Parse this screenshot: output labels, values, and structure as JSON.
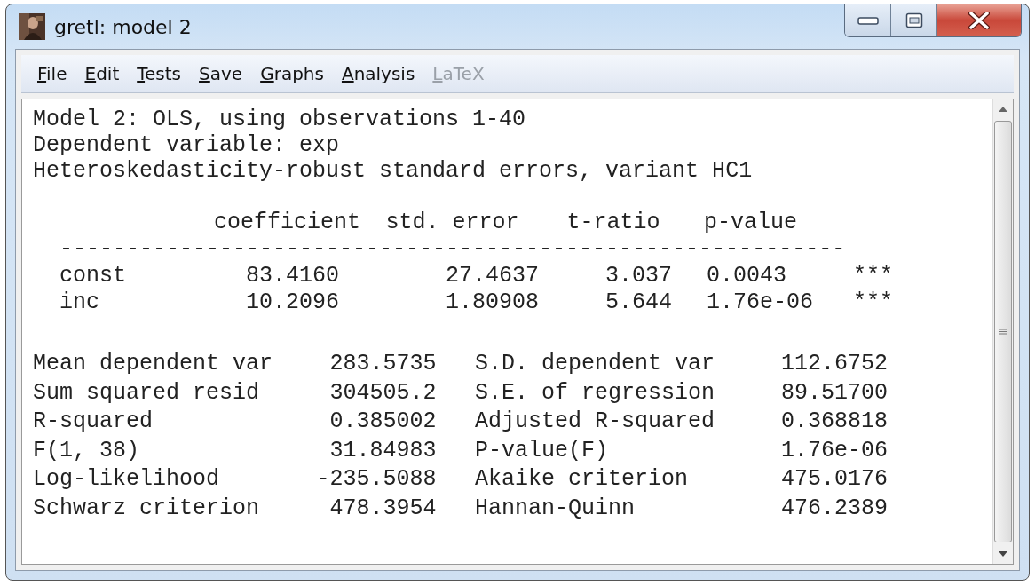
{
  "window": {
    "title": "gretl: model 2"
  },
  "menu": [
    {
      "label": "File",
      "disabled": false
    },
    {
      "label": "Edit",
      "disabled": false
    },
    {
      "label": "Tests",
      "disabled": false
    },
    {
      "label": "Save",
      "disabled": false
    },
    {
      "label": "Graphs",
      "disabled": false
    },
    {
      "label": "Analysis",
      "disabled": false
    },
    {
      "label": "LaTeX",
      "disabled": true
    }
  ],
  "output": {
    "header_lines": [
      "Model 2: OLS, using observations 1-40",
      "Dependent variable: exp",
      "Heteroskedasticity-robust standard errors, variant HC1"
    ],
    "coef_table": {
      "columns": [
        "coefficient",
        "std. error",
        "t-ratio",
        "p-value"
      ],
      "rule": "-----------------------------------------------------------",
      "rows": [
        {
          "name": "const",
          "coefficient": "83.4160",
          "std_error": "27.4637",
          "t_ratio": "3.037",
          "p_value": "0.0043",
          "stars": "***"
        },
        {
          "name": "inc",
          "coefficient": "10.2096",
          "std_error": "1.80908",
          "t_ratio": "5.644",
          "p_value": "1.76e-06",
          "stars": "***"
        }
      ]
    },
    "stats": [
      {
        "label_1": "Mean dependent var",
        "value_1": "283.5735",
        "label_2": "S.D. dependent var",
        "value_2": "112.6752"
      },
      {
        "label_1": "Sum squared resid",
        "value_1": "304505.2",
        "label_2": "S.E. of regression",
        "value_2": "89.51700"
      },
      {
        "label_1": "R-squared",
        "value_1": "0.385002",
        "label_2": "Adjusted R-squared",
        "value_2": "0.368818"
      },
      {
        "label_1": "F(1, 38)",
        "value_1": "31.84983",
        "label_2": "P-value(F)",
        "value_2": "1.76e-06"
      },
      {
        "label_1": "Log-likelihood",
        "value_1": "-235.5088",
        "label_2": "Akaike criterion",
        "value_2": "475.0176"
      },
      {
        "label_1": "Schwarz criterion",
        "value_1": "478.3954",
        "label_2": "Hannan-Quinn",
        "value_2": "476.2389"
      }
    ]
  }
}
